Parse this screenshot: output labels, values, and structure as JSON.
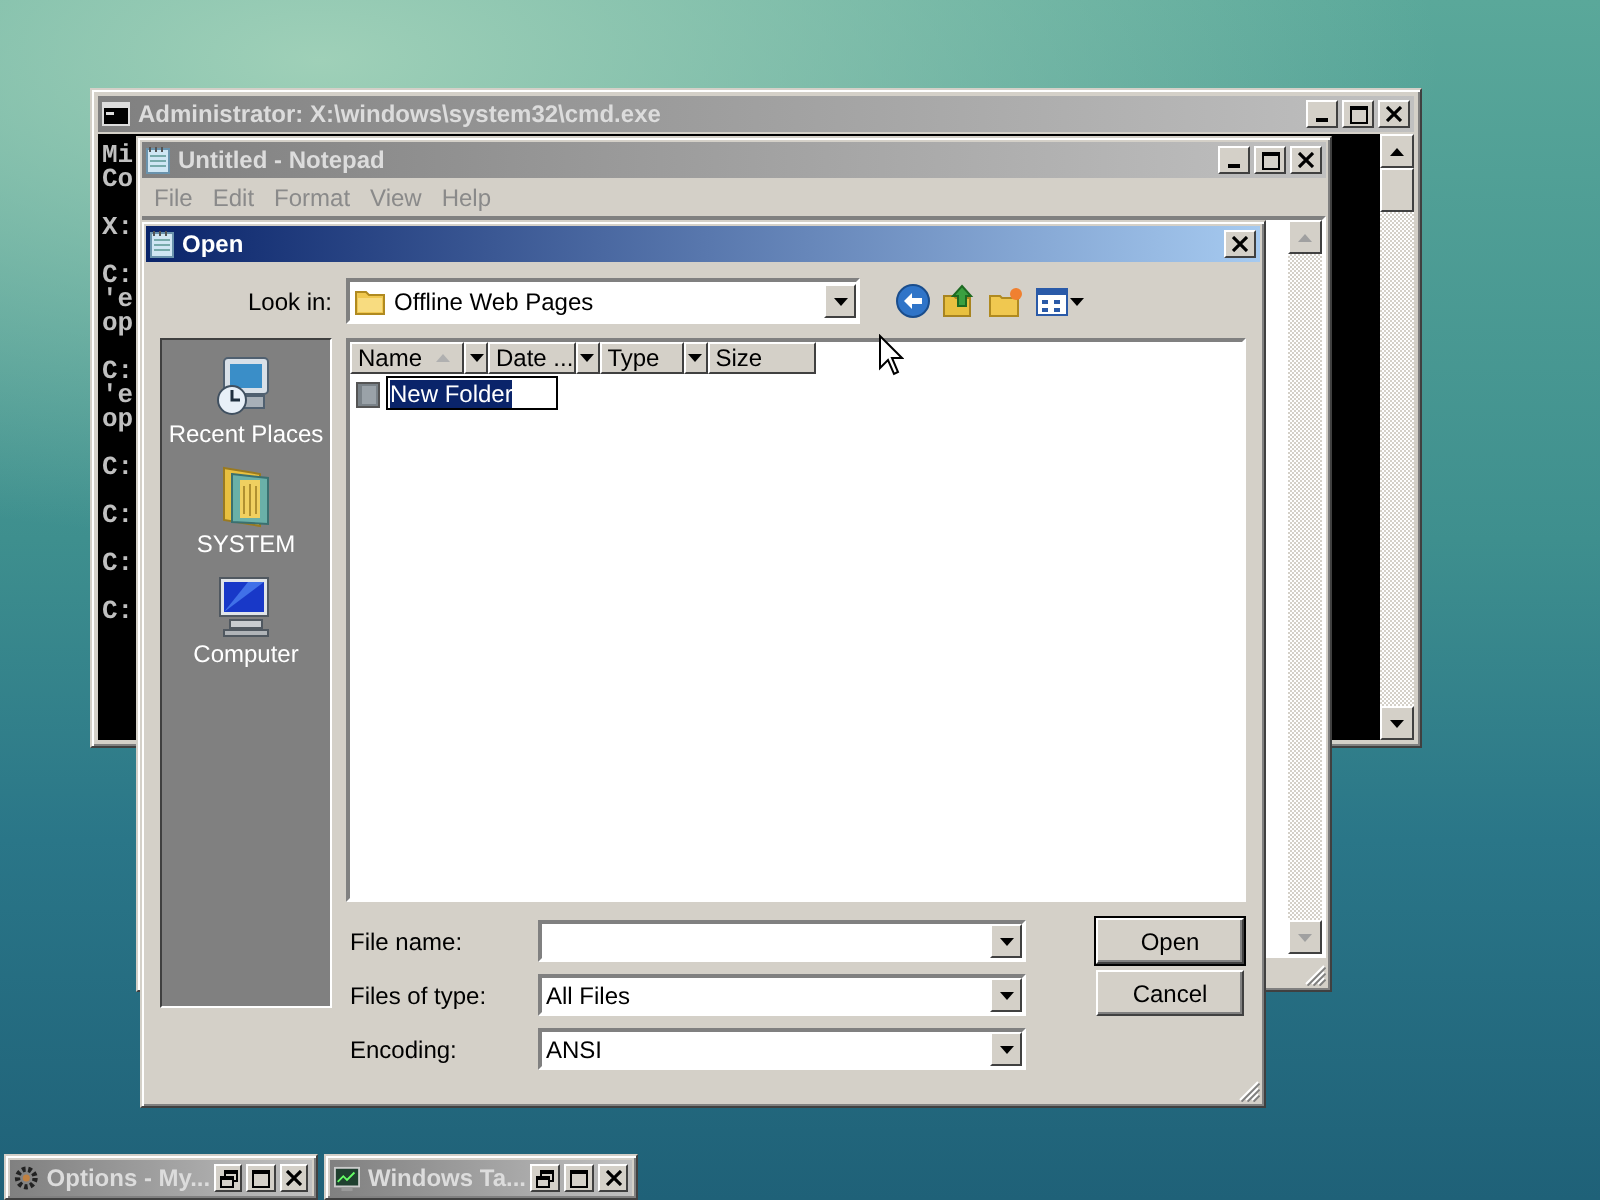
{
  "desktop": {
    "console_window": {
      "title": "Administrator: X:\\windows\\system32\\cmd.exe",
      "active": false,
      "output": [
        [
          "Mi",
          "Co"
        ],
        [
          "X:"
        ],
        [
          "C:",
          "'e",
          "op"
        ],
        [
          "C:",
          "'e",
          "op"
        ],
        [
          "C:"
        ],
        [
          "C:"
        ],
        [
          "C:"
        ],
        [
          "C:"
        ]
      ]
    },
    "notepad_window": {
      "title": "Untitled - Notepad",
      "active": false,
      "menu": [
        "File",
        "Edit",
        "Format",
        "View",
        "Help"
      ]
    },
    "open_dialog": {
      "title": "Open",
      "active": true,
      "look_in": {
        "label": "Look in:",
        "value": "Offline Web Pages"
      },
      "places": [
        {
          "label": "Recent Places",
          "kind": "recent"
        },
        {
          "label": "SYSTEM",
          "kind": "user"
        },
        {
          "label": "Computer",
          "kind": "computer"
        }
      ],
      "columns": [
        {
          "label": "Name",
          "sorted": true
        },
        {
          "label": "Date ...",
          "sorted": false
        },
        {
          "label": "Type",
          "sorted": false
        },
        {
          "label": "Size",
          "sorted": false
        }
      ],
      "items": [
        {
          "name": "New Folder",
          "selected": true
        }
      ],
      "fields": [
        {
          "label": "File name:"
        },
        {
          "label": "Files of type:",
          "value": "All Files"
        },
        {
          "label": "Encoding:",
          "value": "ANSI"
        }
      ],
      "buttons": [
        {
          "label": "Open",
          "default": true
        },
        {
          "label": "Cancel",
          "default": false
        }
      ]
    },
    "minimized_windows": [
      {
        "title": "Options - My...",
        "kind": "options",
        "active": false
      },
      {
        "title": "Windows Ta...",
        "kind": "monitor",
        "active": false
      }
    ]
  }
}
